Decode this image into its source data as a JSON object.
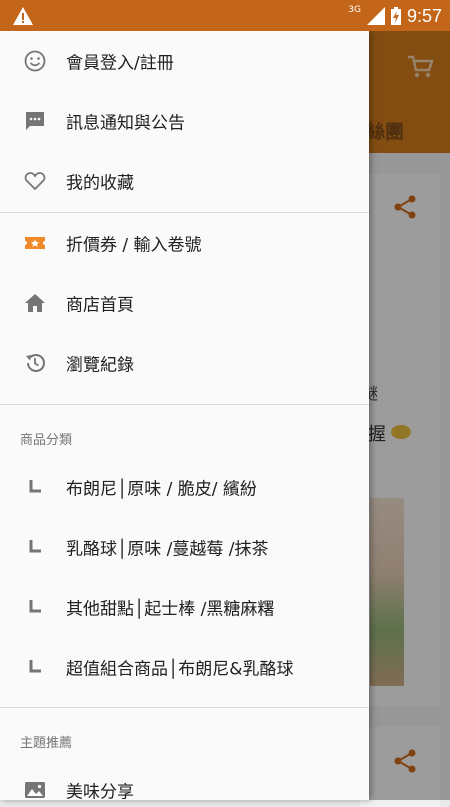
{
  "status": {
    "network": "3G",
    "time": "9:57"
  },
  "background": {
    "header_fragment": "絲團",
    "text_fragment1": "瞇",
    "text_fragment2": "握"
  },
  "drawer": {
    "items_top": [
      {
        "label": "會員登入/註冊",
        "icon": "smiley-icon"
      },
      {
        "label": "訊息通知與公告",
        "icon": "message-icon"
      },
      {
        "label": "我的收藏",
        "icon": "heart-icon"
      }
    ],
    "items_mid": [
      {
        "label": "折價券 / 輸入卷號",
        "icon": "ticket-icon"
      },
      {
        "label": "商店首頁",
        "icon": "home-icon"
      },
      {
        "label": "瀏覽紀錄",
        "icon": "history-icon"
      }
    ],
    "category_header": "商品分類",
    "categories": [
      {
        "label": "布朗尼│原味 / 脆皮/ 繽紛"
      },
      {
        "label": "乳酪球│原味 /蔓越莓 /抹茶"
      },
      {
        "label": "其他甜點│起士棒 /黑糖麻糬"
      },
      {
        "label": "超值組合商品│布朗尼&乳酪球"
      }
    ],
    "theme_header": "主題推薦",
    "themes": [
      {
        "label": "美味分享",
        "icon": "image-icon"
      }
    ]
  },
  "colors": {
    "status_bar": "#c4661a",
    "header": "#c9771c",
    "accent": "#f0892a"
  }
}
